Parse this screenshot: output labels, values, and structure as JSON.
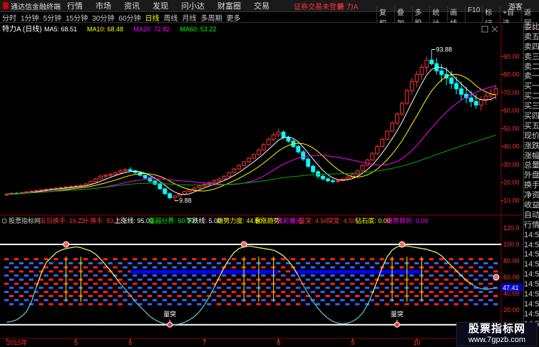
{
  "titlebar": {
    "app_name": "通达信金融终端",
    "menu": [
      "行情",
      "市场",
      "资讯",
      "发现",
      "问小达",
      "财富圈",
      "交易"
    ],
    "notice": "证券交易未登录",
    "stock": "特 力A",
    "user": "游客"
  },
  "toolbar": {
    "periods": [
      "分时",
      "1分钟",
      "5分钟",
      "15分钟",
      "30分钟",
      "60分钟",
      "日线",
      "周线",
      "月线",
      "多周期",
      "更多"
    ],
    "active_period": "日线",
    "tools": [
      "复权",
      "叠加",
      "多股",
      "统计",
      "画线",
      "F10",
      "标记",
      "+自选",
      "返回"
    ]
  },
  "main_chart": {
    "stock_label": "特力A (日线)",
    "ma": [
      {
        "label": "MA5: 68.51",
        "color": "#ffffff"
      },
      {
        "label": "MA10: 68.48",
        "color": "#ffff00"
      },
      {
        "label": "MA20: 72.82",
        "color": "#ff00ff"
      },
      {
        "label": "MA60: 53.22",
        "color": "#00ff00"
      }
    ],
    "high_label": "93.88",
    "low_label": "9.88",
    "y_ticks": [
      {
        "v": 90,
        "label": "90.00"
      },
      {
        "v": 80,
        "label": "80.00"
      },
      {
        "v": 70,
        "label": "70.00"
      },
      {
        "v": 60,
        "label": "60.00"
      },
      {
        "v": 50,
        "label": "50.00"
      },
      {
        "v": 40,
        "label": "40.00"
      },
      {
        "v": 30,
        "label": "30.00"
      },
      {
        "v": 20,
        "label": "20.00"
      },
      {
        "v": 10,
        "label": "10.00"
      }
    ]
  },
  "indicator": {
    "name": "股票指标网",
    "items": [
      {
        "label": "五日换手: 16.73",
        "color": "#ff3333"
      },
      {
        "label": "二十换手: 83.12",
        "color": "#ff3333"
      },
      {
        "label": "上涨线: 95.00",
        "color": "#ffffff"
      },
      {
        "label": "强弱分界: 50.00",
        "color": "#00ff00"
      },
      {
        "label": "下跌线: 5.00",
        "color": "#ffffff"
      },
      {
        "label": "趋势力度: 44.50",
        "color": "#ffff00"
      },
      {
        "label": "看涨趋势: ",
        "color": "#ffff00"
      },
      {
        "label": "炫彩魔光: ",
        "color": "#ff00ff"
      },
      {
        "label": "量突: 4.50",
        "color": "#ff3333"
      },
      {
        "label": "突变: 4.50",
        "color": "#ff3333"
      },
      {
        "label": "钻石底: 0.00",
        "color": "#ffff00"
      },
      {
        "label": "趋势转折: 0.00",
        "color": "#ff00ff"
      }
    ],
    "y_ticks": [
      {
        "v": 120,
        "label": "120.0"
      },
      {
        "v": 100,
        "label": "100.0"
      },
      {
        "v": 80,
        "label": "80.00"
      },
      {
        "v": 60,
        "label": "60.00"
      },
      {
        "v": 40,
        "label": "40.00"
      },
      {
        "v": 20,
        "label": "20.00"
      }
    ],
    "current_value": "47.41",
    "event_label": "量突"
  },
  "x_axis": {
    "labels": [
      {
        "i": 0,
        "label": "2015年"
      },
      {
        "i": 14,
        "label": "5"
      },
      {
        "i": 25,
        "label": "6"
      },
      {
        "i": 40,
        "label": "7"
      },
      {
        "i": 55,
        "label": "8"
      },
      {
        "i": 70,
        "label": "9"
      },
      {
        "i": 83,
        "label": "10"
      },
      {
        "i": 98,
        "label": "11"
      }
    ]
  },
  "right_panel": [
    "委比",
    "卖五",
    "卖四",
    "卖三",
    "卖二",
    "卖一",
    "买一",
    "买二",
    "买三",
    "买四",
    "买五",
    "现价",
    "涨跌",
    "涨幅",
    "总量",
    "外盘",
    "换手",
    "净资",
    "收益",
    "自动",
    "行情",
    "14:50",
    "14:50",
    "14:50",
    "14:50",
    "14:50",
    "14:50",
    "14:50",
    "14:50",
    "14:50",
    "14:50"
  ],
  "side_flag": "L",
  "watermark": {
    "line1": "股票指标网",
    "line2": "www.7gpzb.com"
  },
  "chart_data": {
    "type": "candlestick",
    "ohlc": [
      [
        13,
        14,
        12.5,
        13.5
      ],
      [
        13.5,
        14.5,
        13,
        14
      ],
      [
        14,
        14.6,
        13.5,
        13.8
      ],
      [
        13.8,
        14.8,
        13.4,
        14.5
      ],
      [
        14.5,
        15.2,
        14,
        14.8
      ],
      [
        14.8,
        15.6,
        14.4,
        15.2
      ],
      [
        15.2,
        16,
        14.8,
        15.5
      ],
      [
        15.5,
        16.4,
        15,
        16
      ],
      [
        16,
        16.8,
        15.5,
        16.2
      ],
      [
        16.2,
        17,
        15.8,
        16.6
      ],
      [
        16.6,
        17.4,
        16,
        16.9
      ],
      [
        16.9,
        17.6,
        16.3,
        17.2
      ],
      [
        17.2,
        18,
        16.8,
        17.5
      ],
      [
        17.5,
        18.4,
        17,
        17.8
      ],
      [
        17.8,
        18.6,
        17.2,
        18.1
      ],
      [
        18.1,
        19,
        17.6,
        18.4
      ],
      [
        18.4,
        19.8,
        18,
        19.2
      ],
      [
        19.2,
        21,
        18.8,
        20.5
      ],
      [
        20.5,
        22.5,
        20,
        22
      ],
      [
        22,
        24.5,
        21.5,
        23.5
      ],
      [
        23.5,
        25,
        22.5,
        24
      ],
      [
        24,
        25.5,
        23,
        24.5
      ],
      [
        24.5,
        26,
        23.5,
        25.5
      ],
      [
        25.5,
        27.5,
        25,
        26.5
      ],
      [
        26.5,
        28,
        25.8,
        27.2
      ],
      [
        27.2,
        28.5,
        26,
        26.5
      ],
      [
        26.5,
        27,
        25,
        25.5
      ],
      [
        25.5,
        26,
        23.5,
        24
      ],
      [
        24,
        24.5,
        22,
        22.5
      ],
      [
        22.5,
        23,
        20,
        20.8
      ],
      [
        20.8,
        21.5,
        18.5,
        19
      ],
      [
        19,
        19.5,
        16,
        16.5
      ],
      [
        16.5,
        17,
        13,
        13.8
      ],
      [
        13.8,
        14.5,
        10.5,
        11.5
      ],
      [
        11.5,
        13,
        9.88,
        12.5
      ],
      [
        12.5,
        14,
        12,
        13.5
      ],
      [
        13.5,
        15.5,
        13,
        15
      ],
      [
        15,
        16.5,
        14.5,
        16
      ],
      [
        16,
        17.5,
        15.5,
        17
      ],
      [
        17,
        18.5,
        16.5,
        18
      ],
      [
        18,
        19.5,
        17.5,
        19
      ],
      [
        19,
        20.5,
        18.5,
        20
      ],
      [
        20,
        21.5,
        19.5,
        21
      ],
      [
        21,
        22.5,
        20.5,
        22
      ],
      [
        22,
        24,
        21.5,
        23.5
      ],
      [
        23.5,
        26,
        23,
        25.5
      ],
      [
        25.5,
        28,
        25,
        27.5
      ],
      [
        27.5,
        30,
        27,
        29.5
      ],
      [
        29.5,
        32,
        29,
        31.5
      ],
      [
        31.5,
        34,
        31,
        33.5
      ],
      [
        33.5,
        36,
        33,
        35.5
      ],
      [
        35.5,
        39,
        35,
        38
      ],
      [
        38,
        42,
        37.5,
        41
      ],
      [
        41,
        45,
        40.5,
        44
      ],
      [
        44,
        48,
        43,
        46.5
      ],
      [
        46.5,
        50,
        45,
        48
      ],
      [
        48,
        49,
        44,
        45
      ],
      [
        45,
        46,
        42,
        43
      ],
      [
        43,
        44,
        39,
        40
      ],
      [
        40,
        41,
        36,
        37
      ],
      [
        37,
        38,
        32,
        33
      ],
      [
        33,
        34,
        28,
        29
      ],
      [
        29,
        30,
        25,
        26
      ],
      [
        26,
        27,
        22,
        23.5
      ],
      [
        23.5,
        24.5,
        21,
        22
      ],
      [
        22,
        23,
        20,
        21
      ],
      [
        21,
        22,
        19.5,
        20.5
      ],
      [
        20.5,
        21.5,
        19.5,
        21
      ],
      [
        21,
        22.5,
        20.5,
        22
      ],
      [
        22,
        23.5,
        21.5,
        23
      ],
      [
        23,
        25,
        22.5,
        24.5
      ],
      [
        24.5,
        27,
        24,
        26.5
      ],
      [
        26.5,
        30,
        26,
        29.5
      ],
      [
        29.5,
        33,
        29,
        32.5
      ],
      [
        32.5,
        37,
        32,
        36
      ],
      [
        36,
        41,
        35.5,
        40
      ],
      [
        40,
        45,
        39.5,
        44
      ],
      [
        44,
        49,
        43.5,
        48.5
      ],
      [
        48.5,
        54,
        48,
        53
      ],
      [
        53,
        59,
        52,
        58
      ],
      [
        58,
        65,
        57,
        64
      ],
      [
        64,
        72,
        63,
        71
      ],
      [
        71,
        78,
        69,
        76
      ],
      [
        76,
        82,
        73,
        80
      ],
      [
        80,
        86,
        77,
        84
      ],
      [
        84,
        90,
        81,
        88
      ],
      [
        88,
        93.88,
        85,
        86
      ],
      [
        86,
        89,
        80,
        82
      ],
      [
        82,
        86,
        76,
        80
      ],
      [
        80,
        84,
        74,
        78
      ],
      [
        78,
        82,
        72,
        75
      ],
      [
        75,
        79,
        69,
        72
      ],
      [
        72,
        76,
        66,
        69
      ],
      [
        69,
        73,
        64,
        67
      ],
      [
        67,
        71,
        62,
        65
      ],
      [
        65,
        69,
        61,
        63
      ],
      [
        63,
        68,
        60,
        66
      ],
      [
        66,
        70,
        63,
        68
      ],
      [
        68,
        72,
        65,
        69
      ],
      [
        69,
        74,
        66,
        72
      ]
    ],
    "indicator_line": [
      5,
      6,
      8,
      12,
      18,
      30,
      48,
      65,
      78,
      84,
      90,
      93,
      95,
      96,
      97,
      96,
      94,
      92,
      88,
      82,
      75,
      68,
      60,
      52,
      45,
      38,
      30,
      24,
      18,
      12,
      8,
      5,
      3,
      2,
      2,
      3,
      5,
      8,
      12,
      18,
      26,
      36,
      48,
      60,
      72,
      82,
      90,
      95,
      97,
      98,
      97,
      96,
      95,
      94,
      93,
      90,
      86,
      80,
      72,
      62,
      50,
      40,
      30,
      22,
      15,
      10,
      6,
      4,
      3,
      4,
      6,
      10,
      16,
      26,
      40,
      56,
      72,
      85,
      93,
      97,
      98,
      98,
      97,
      96,
      95,
      94,
      92,
      90,
      86,
      80,
      74,
      68,
      62,
      56,
      52,
      48,
      46,
      45,
      46,
      47
    ],
    "event_indices": [
      33,
      79
    ],
    "peak_indices": [
      12,
      48,
      80
    ]
  }
}
